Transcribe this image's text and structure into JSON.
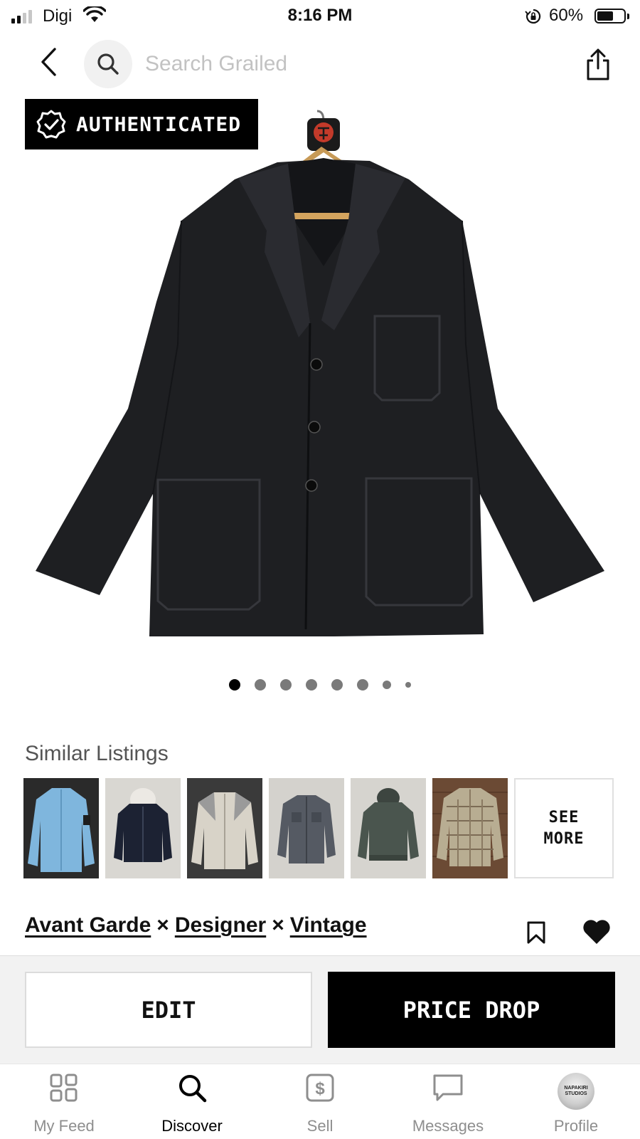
{
  "status_bar": {
    "carrier": "Digi",
    "time": "8:16 PM",
    "battery_percent": "60%",
    "battery_level": 0.6
  },
  "nav": {
    "search_placeholder": "Search Grailed"
  },
  "hero": {
    "badge_label": "AUTHENTICATED",
    "image_count": 8,
    "active_image": 1
  },
  "similar": {
    "title": "Similar Listings",
    "see_more_line1": "SEE",
    "see_more_line2": "MORE"
  },
  "designers": {
    "items": [
      "Avant Garde",
      "Designer",
      "Vintage"
    ],
    "separator": "×"
  },
  "actions": {
    "edit_label": "EDIT",
    "price_drop_label": "PRICE DROP"
  },
  "tabs": [
    {
      "label": "My Feed",
      "icon": "feed-grid-icon",
      "active": false
    },
    {
      "label": "Discover",
      "icon": "search-icon",
      "active": true
    },
    {
      "label": "Sell",
      "icon": "dollar-tag-icon",
      "active": false
    },
    {
      "label": "Messages",
      "icon": "chat-bubble-icon",
      "active": false
    },
    {
      "label": "Profile",
      "icon": "avatar",
      "active": false
    }
  ],
  "profile_avatar_text": "NAPAKIRI STUDIOS",
  "colors": {
    "badge_bg": "#000000",
    "price_drop_bg": "#000000",
    "jacket": "#1e1f22"
  }
}
